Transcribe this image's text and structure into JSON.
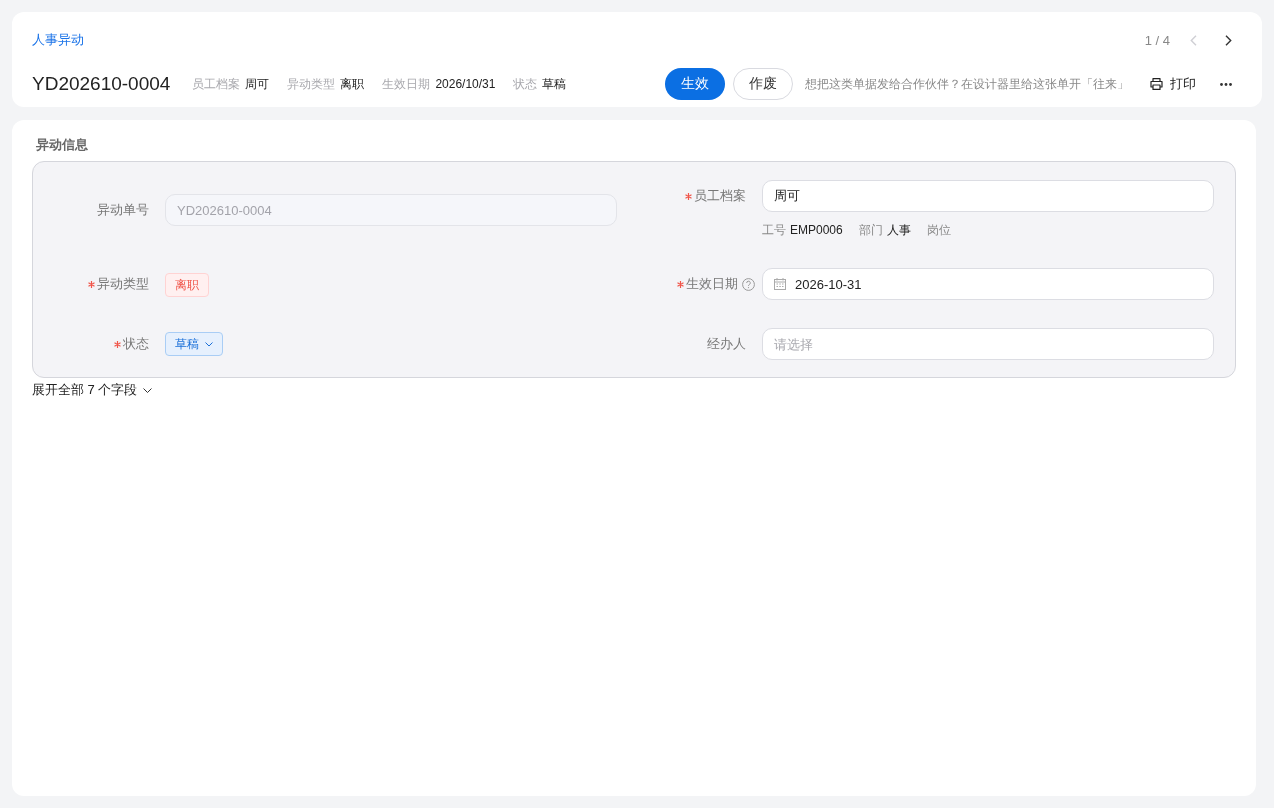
{
  "header": {
    "module": "人事异动",
    "pager": {
      "position": "1 / 4",
      "buttons": [
        {
          "kind": "prev",
          "disabled": true
        },
        {
          "kind": "next",
          "disabled": false
        }
      ]
    },
    "doc_no": "YD202610-0004",
    "summary": [
      {
        "label": "员工档案",
        "value": "周可"
      },
      {
        "label": "异动类型",
        "value": "离职"
      },
      {
        "label": "生效日期",
        "value": "2026/10/31"
      },
      {
        "label": "状态",
        "value": "草稿"
      }
    ],
    "actions": [
      {
        "kind": "primary",
        "label": "生效"
      },
      {
        "kind": "default",
        "label": "作废"
      }
    ],
    "hint": "想把这类单据发给合作伙伴？在设计器里给这张单开「往来」",
    "print": "打印"
  },
  "section": {
    "title": "异动信息",
    "fields": [
      {
        "kind": "text",
        "label": "异动单号",
        "required": false,
        "help": false,
        "value": "YD202610-0004",
        "disabled": true
      },
      {
        "kind": "text",
        "label": "员工档案",
        "required": true,
        "help": false,
        "value": "周可",
        "disabled": false,
        "details": [
          {
            "label": "工号",
            "value": "EMP0006"
          },
          {
            "label": "部门",
            "value": "人事"
          },
          {
            "label": "岗位"
          }
        ]
      },
      {
        "kind": "tag",
        "label": "异动类型",
        "required": true,
        "help": false,
        "value": "离职"
      },
      {
        "kind": "date",
        "label": "生效日期",
        "required": true,
        "help": true,
        "value": "2026-10-31"
      },
      {
        "kind": "select_tag",
        "label": "状态",
        "required": true,
        "help": false,
        "value": "草稿"
      },
      {
        "kind": "select",
        "label": "经办人",
        "required": false,
        "help": false,
        "placeholder": "请选择"
      }
    ],
    "expand": "展开全部 7 个字段"
  }
}
